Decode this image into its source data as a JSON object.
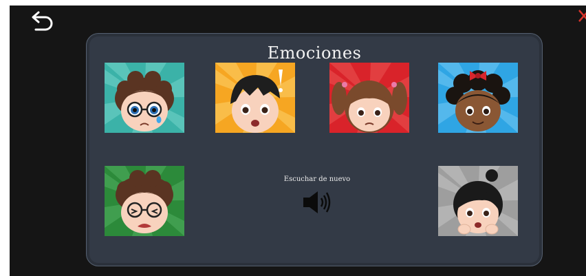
{
  "title": "Emociones",
  "replay": {
    "label": "Escuchar de nuevo",
    "icon": "speaker-icon"
  },
  "nav": {
    "back_icon": "undo-arrow-icon",
    "close_icon": "close-x-icon"
  },
  "cards": [
    {
      "character": "boy-glasses-crying",
      "background": "#3bb2a8"
    },
    {
      "character": "boy-surprised-exclamation",
      "background": "#f6a622"
    },
    {
      "character": "girl-pigtails-sad",
      "background": "#d9232a"
    },
    {
      "character": "girl-bow-smiling",
      "background": "#2fa5e4"
    },
    {
      "character": "boy-glasses-disgusted",
      "background": "#2c8a3a"
    },
    {
      "character": "girl-bun-scared",
      "background": "#9e9e9e"
    }
  ],
  "colors": {
    "screen": "#151515",
    "panel": "#333a46",
    "close": "#d9342b"
  }
}
